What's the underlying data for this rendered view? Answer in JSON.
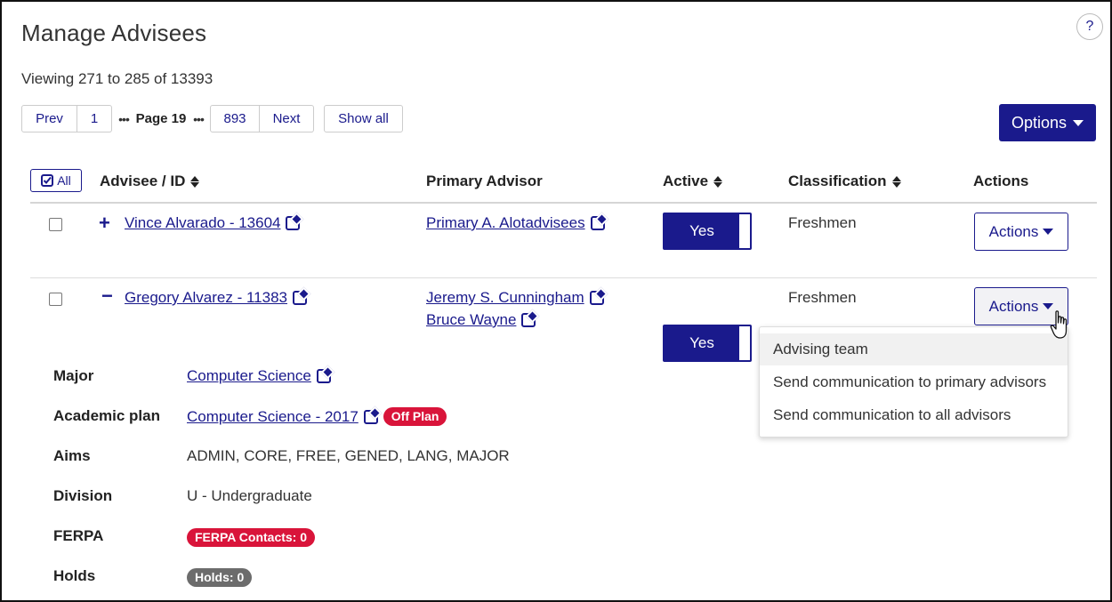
{
  "page": {
    "title": "Manage Advisees",
    "help": "?",
    "viewing": "Viewing 271 to 285 of 13393"
  },
  "pager": {
    "prev": "Prev",
    "first": "1",
    "ellipsis": "•••",
    "current": "Page 19",
    "last": "893",
    "next": "Next",
    "show_all": "Show all"
  },
  "options_label": "Options",
  "table": {
    "select_all": "All",
    "headers": {
      "advisee": "Advisee / ID",
      "primary_advisor": "Primary Advisor",
      "active": "Active",
      "classification": "Classification",
      "actions": "Actions"
    },
    "rows": [
      {
        "toggle": "+",
        "advisee": "Vince Alvarado - 13604",
        "advisors": [
          "Primary A. Alotadvisees"
        ],
        "active": "Yes",
        "classification": "Freshmen",
        "actions": "Actions"
      },
      {
        "toggle": "−",
        "advisee": "Gregory Alvarez - 11383",
        "advisors": [
          "Jeremy S. Cunningham",
          "Bruce Wayne"
        ],
        "active": "Yes",
        "classification": "Freshmen",
        "actions": "Actions"
      }
    ]
  },
  "actions_menu": [
    "Advising team",
    "Send communication to primary advisors",
    "Send communication to all advisors"
  ],
  "details": {
    "major": {
      "label": "Major",
      "value": "Computer Science"
    },
    "plan": {
      "label": "Academic plan",
      "value": "Computer Science - 2017",
      "badge": "Off Plan"
    },
    "aims": {
      "label": "Aims",
      "value": "ADMIN, CORE, FREE, GENED, LANG, MAJOR"
    },
    "division": {
      "label": "Division",
      "value": "U - Undergraduate"
    },
    "ferpa": {
      "label": "FERPA",
      "badge": "FERPA Contacts: 0"
    },
    "holds": {
      "label": "Holds",
      "badge": "Holds: 0"
    }
  },
  "colors": {
    "primary": "#1a1a8c",
    "danger": "#d9143a",
    "neutral_badge": "#6c6c6c"
  }
}
